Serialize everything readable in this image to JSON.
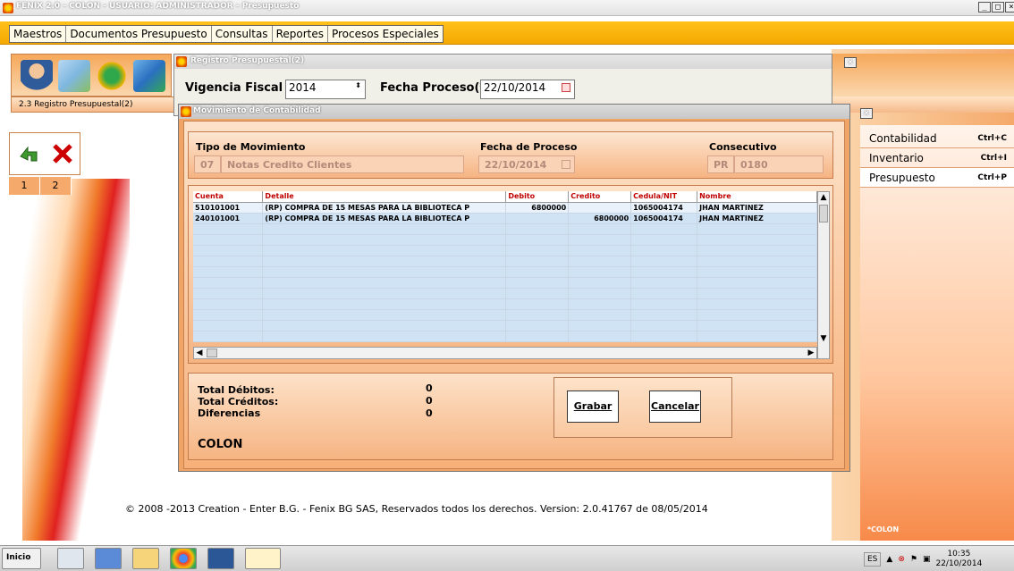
{
  "app": {
    "title": "FENIX 2.0 - COLON - USUARIO: ADMINISTRADOR - Presupuesto"
  },
  "menu": [
    "Maestros",
    "Documentos Presupuesto",
    "Consultas",
    "Reportes",
    "Procesos Especiales"
  ],
  "left": {
    "breadcrumb": "2.3 Registro Presupuestal(2)",
    "pages": [
      "1",
      "2"
    ]
  },
  "reg_window": {
    "title": "Registro Presupuestal(2)",
    "vigencia_label": "Vigencia Fiscal",
    "vigencia_value": "2014",
    "fecha_label": "Fecha Proceso(*)",
    "fecha_value": "22/10/2014"
  },
  "right_menu": [
    {
      "label": "Contabilidad",
      "shortcut": "Ctrl+C"
    },
    {
      "label": "Inventario",
      "shortcut": "Ctrl+I"
    },
    {
      "label": "Presupuesto",
      "shortcut": "Ctrl+P"
    }
  ],
  "dialog": {
    "title": "Movimiento de Contabilidad",
    "tipo_label": "Tipo de Movimiento",
    "tipo_code": "07",
    "tipo_name": "Notas Credito Clientes",
    "fecha_label": "Fecha de Proceso",
    "fecha_value": "22/10/2014",
    "consec_label": "Consecutivo",
    "consec_prefix": "PR",
    "consec_value": "0180",
    "columns": [
      "Cuenta",
      "Detalle",
      "Debito",
      "Credito",
      "Cedula/NIT",
      "Nombre"
    ],
    "rows": [
      {
        "cuenta": "510101001",
        "detalle": "(RP) COMPRA DE 15 MESAS PARA LA BIBLIOTECA P",
        "debito": "6800000",
        "credito": "",
        "nit": "1065004174",
        "nombre": "JHAN MARTINEZ"
      },
      {
        "cuenta": "240101001",
        "detalle": "(RP) COMPRA DE 15 MESAS PARA LA BIBLIOTECA P",
        "debito": "",
        "credito": "6800000",
        "nit": "1065004174",
        "nombre": "JHAN MARTINEZ"
      }
    ],
    "totals": [
      {
        "label": "Total Débitos:",
        "value": "0"
      },
      {
        "label": "Total Créditos:",
        "value": "0"
      },
      {
        "label": "Diferencias",
        "value": "0"
      }
    ],
    "entity": "COLON",
    "save_label": "Grabar",
    "cancel_label": "Cancelar"
  },
  "footer": "© 2008 -2013 Creation - Enter B.G. - Fenix BG SAS, Reservados todos los derechos.   Version: 2.0.41767 de 08/05/2014",
  "taskbar": {
    "start_label": "Inicio",
    "lang": "ES",
    "time": "10:35",
    "date": "22/10/2014",
    "side_label": "*COLON"
  }
}
